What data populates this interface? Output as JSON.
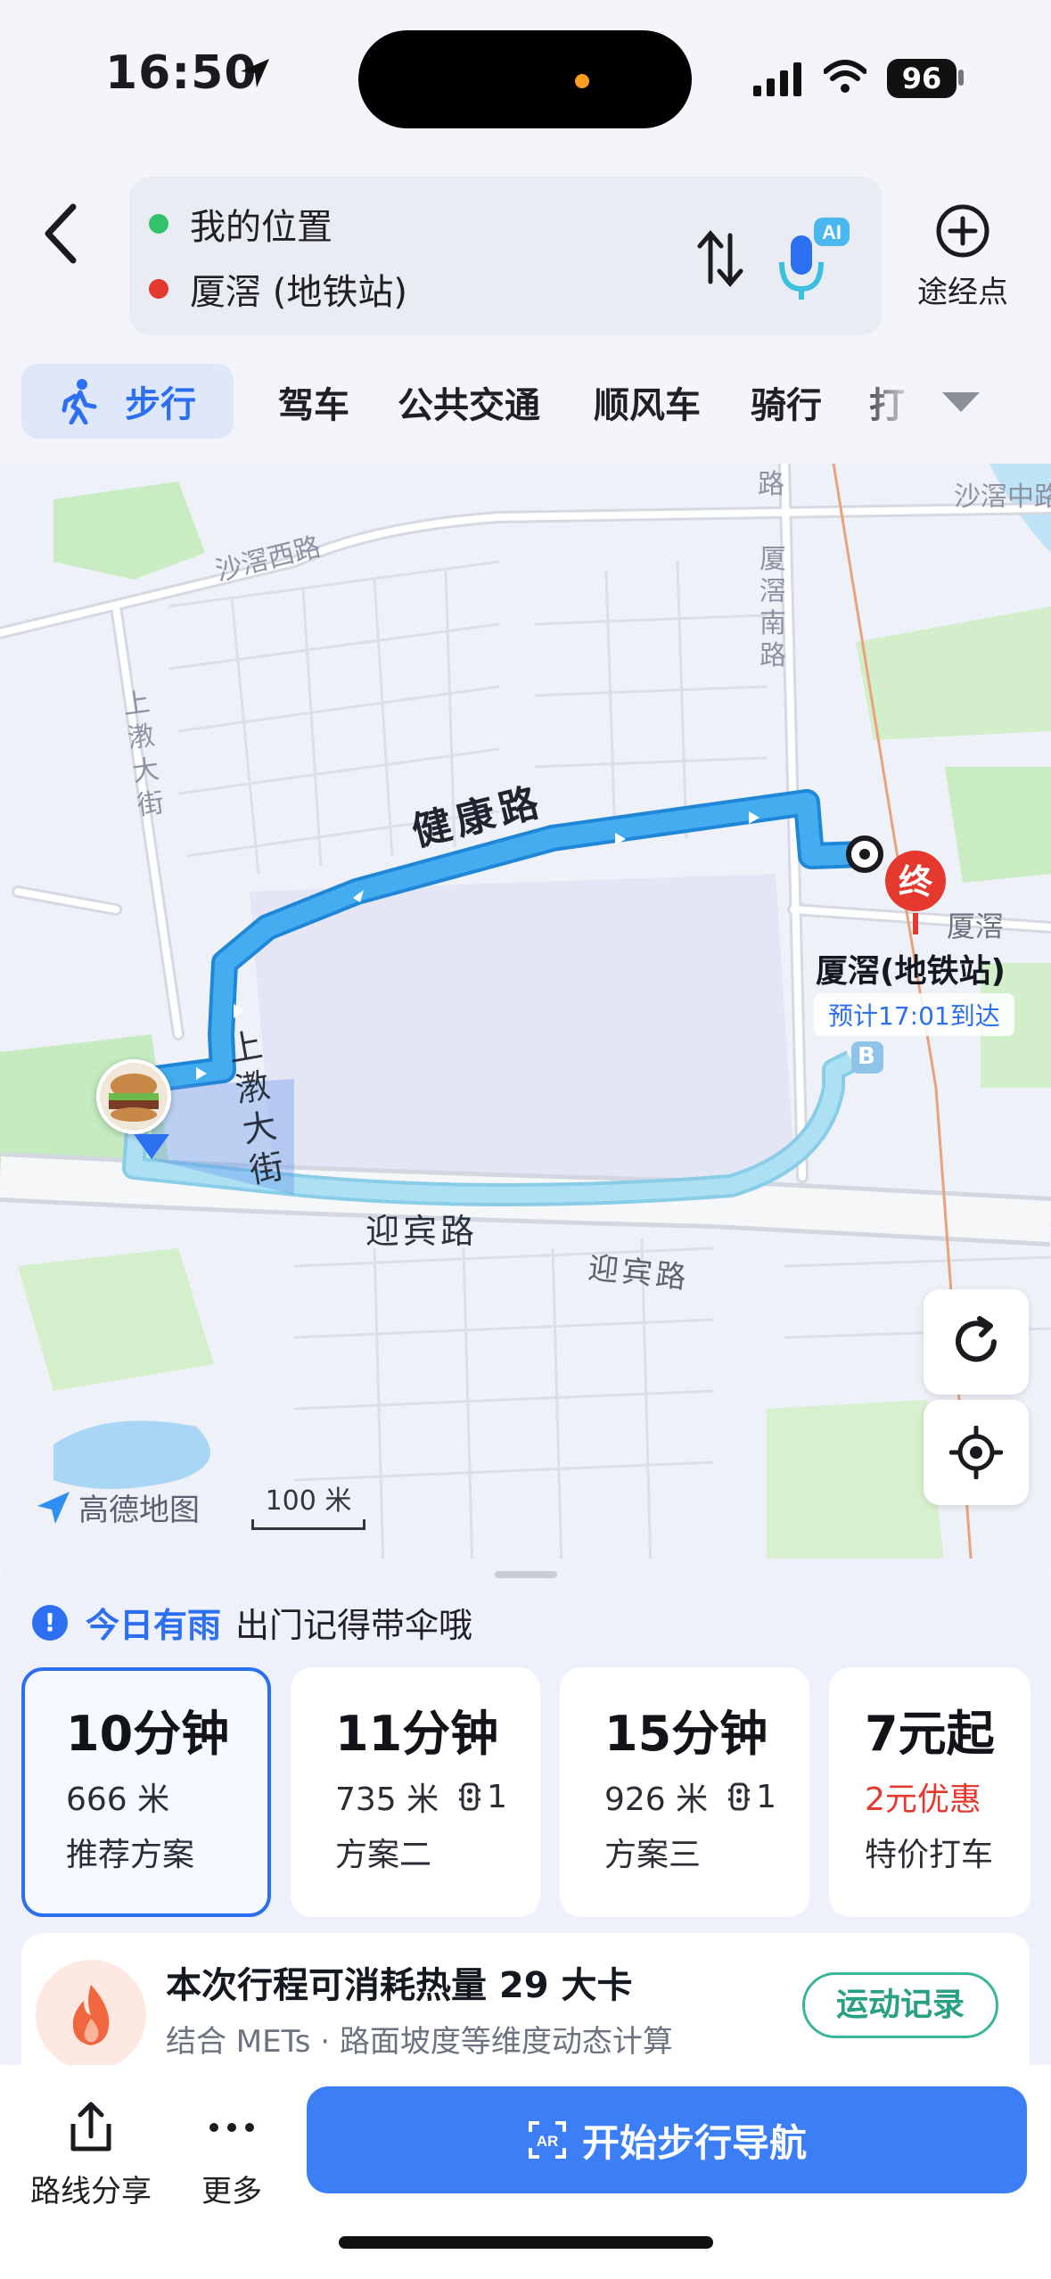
{
  "status_bar": {
    "time": "16:50",
    "battery": "96"
  },
  "search": {
    "origin": "我的位置",
    "destination": "厦滘 (地铁站)",
    "waypoint_label": "途经点",
    "ai_badge": "AI"
  },
  "modes": {
    "active": "步行",
    "items": [
      "驾车",
      "公共交通",
      "顺风车",
      "骑行",
      "打"
    ]
  },
  "map": {
    "roads": {
      "shajiao_west": "沙滘西路",
      "shajiao_middle": "沙滘中路",
      "xiajiao_south": "厦滘南路",
      "shangdun_top": "上漖大街",
      "jiankang": "健康路",
      "shangdun_route": "上漖大街",
      "yingbin_route": "迎宾路",
      "yingbin": "迎宾路",
      "road_top": "路"
    },
    "destination_label": "厦滘(地铁站)",
    "destination_sub": "厦滘",
    "end_marker": "终",
    "eta": "预计17:01到达",
    "exit_marker": "B",
    "logo": "高德地图",
    "scale": "100 米"
  },
  "notice": {
    "strong": "今日有雨",
    "text": "出门记得带伞哦"
  },
  "plans": [
    {
      "time": "10分钟",
      "distance": "666 米",
      "lights": "",
      "name": "推荐方案",
      "selected": true
    },
    {
      "time": "11分钟",
      "distance": "735 米",
      "lights": "1",
      "name": "方案二",
      "selected": false
    },
    {
      "time": "15分钟",
      "distance": "926 米",
      "lights": "1",
      "name": "方案三",
      "selected": false
    }
  ],
  "taxi_plan": {
    "price": "7元起",
    "promo": "2元优惠",
    "name": "特价打车"
  },
  "calorie": {
    "title": "本次行程可消耗热量 29 大卡",
    "subtitle": "结合 METs · 路面坡度等维度动态计算",
    "button": "运动记录"
  },
  "bottom": {
    "share": "路线分享",
    "more": "更多",
    "navigate": "开始步行导航",
    "ar_badge": "AR"
  },
  "colors": {
    "accent": "#2d6ff1",
    "route": "#3da3ee",
    "alt_route": "#9fd7f2",
    "promo": "#e5382f"
  }
}
